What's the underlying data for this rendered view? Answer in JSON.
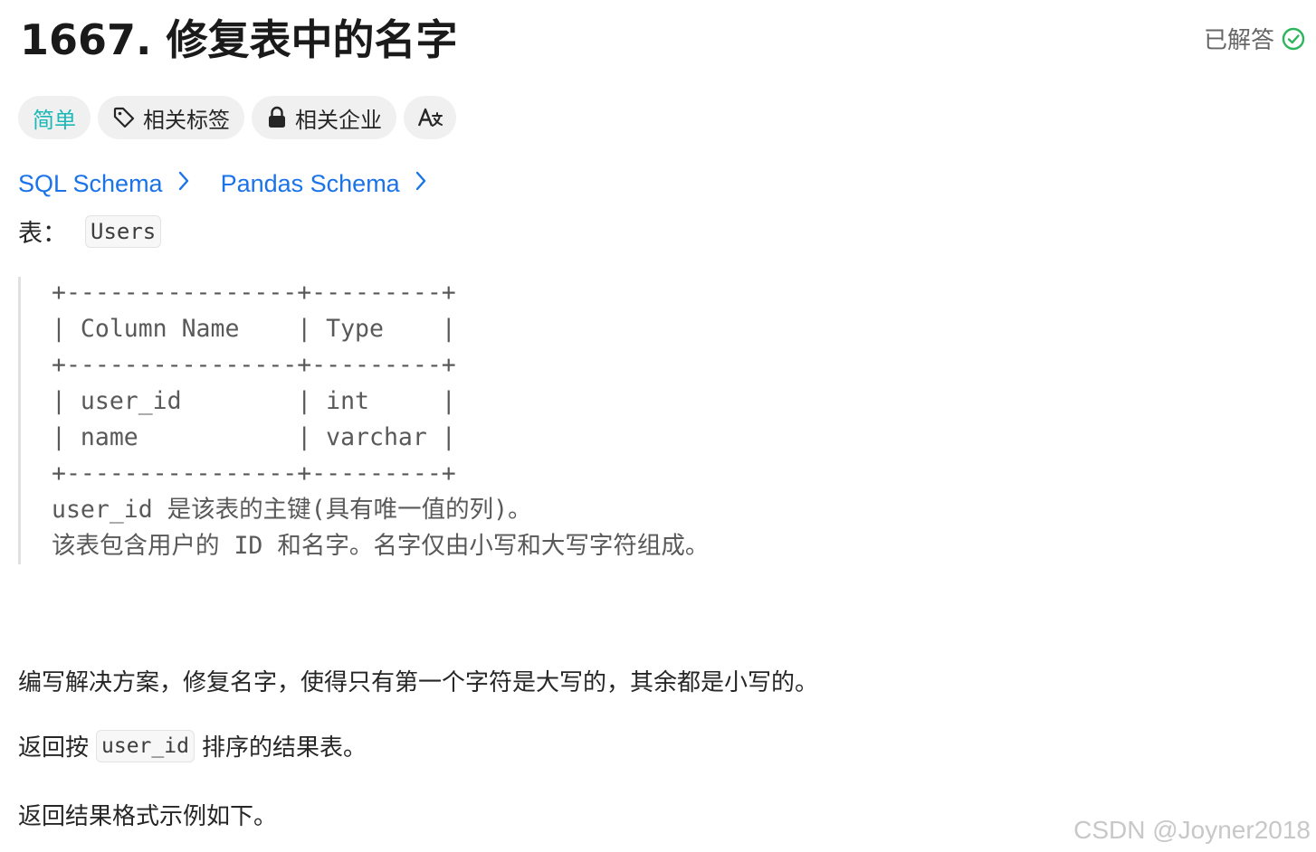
{
  "problem": {
    "title": "1667. 修复表中的名字",
    "status_label": "已解答"
  },
  "tags": {
    "difficulty": "简单",
    "topics": "相关标签",
    "companies": "相关企业",
    "language_icon": "Aあ"
  },
  "schema_links": [
    {
      "label": "SQL Schema"
    },
    {
      "label": "Pandas Schema"
    }
  ],
  "table_intro": {
    "label": "表：",
    "table_name": "Users"
  },
  "schema_lines": [
    "+----------------+---------+",
    "| Column Name    | Type    |",
    "+----------------+---------+",
    "| user_id        | int     |",
    "| name           | varchar |",
    "+----------------+---------+",
    "user_id 是该表的主键(具有唯一值的列)。",
    "该表包含用户的 ID 和名字。名字仅由小写和大写字符组成。"
  ],
  "description": {
    "task": "编写解决方案，修复名字，使得只有第一个字符是大写的，其余都是小写的。",
    "order_prefix": "返回按",
    "order_code": "user_id",
    "order_suffix": "排序的结果表。",
    "example_intro": "返回结果格式示例如下。"
  },
  "watermark": "CSDN @Joyner2018",
  "colors": {
    "link": "#1a73e8",
    "easy": "#1cb8b8",
    "solved_check": "#2db55d"
  },
  "icons": {
    "solved": "check-circle-icon",
    "topics": "tag-icon",
    "companies": "lock-icon",
    "language": "translate-icon",
    "link_arrow": "chevron-right-icon"
  }
}
